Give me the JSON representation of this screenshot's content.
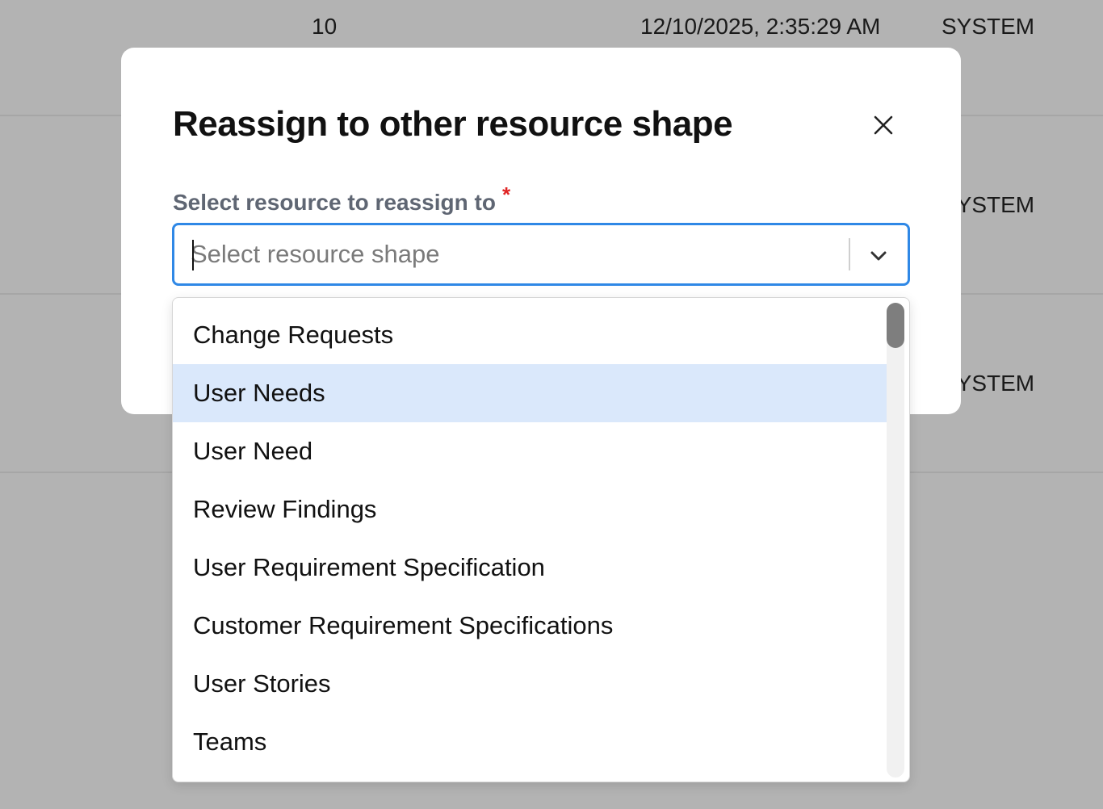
{
  "background_table": {
    "rows": [
      {
        "count": "10",
        "timestamp": "12/10/2025, 2:35:29 AM",
        "author": "SYSTEM"
      },
      {
        "author": "SYSTEM"
      },
      {
        "author": "SYSTEM"
      }
    ]
  },
  "modal": {
    "title": "Reassign to other resource shape",
    "close_icon": "close-icon",
    "field_label": "Select resource to reassign to",
    "required_mark": "*",
    "select": {
      "placeholder": "Select resource shape",
      "value": ""
    },
    "options": [
      "Change Requests",
      "User Needs",
      "User Need",
      "Review Findings",
      "User Requirement Specification",
      "Customer Requirement Specifications",
      "User Stories",
      "Teams"
    ],
    "highlighted_option": "User Needs"
  },
  "colors": {
    "overlay": "#b2b2b2",
    "focus_border": "#2f88e6",
    "highlight": "#dae8fb",
    "required": "#e02424",
    "label": "#5f6673"
  }
}
